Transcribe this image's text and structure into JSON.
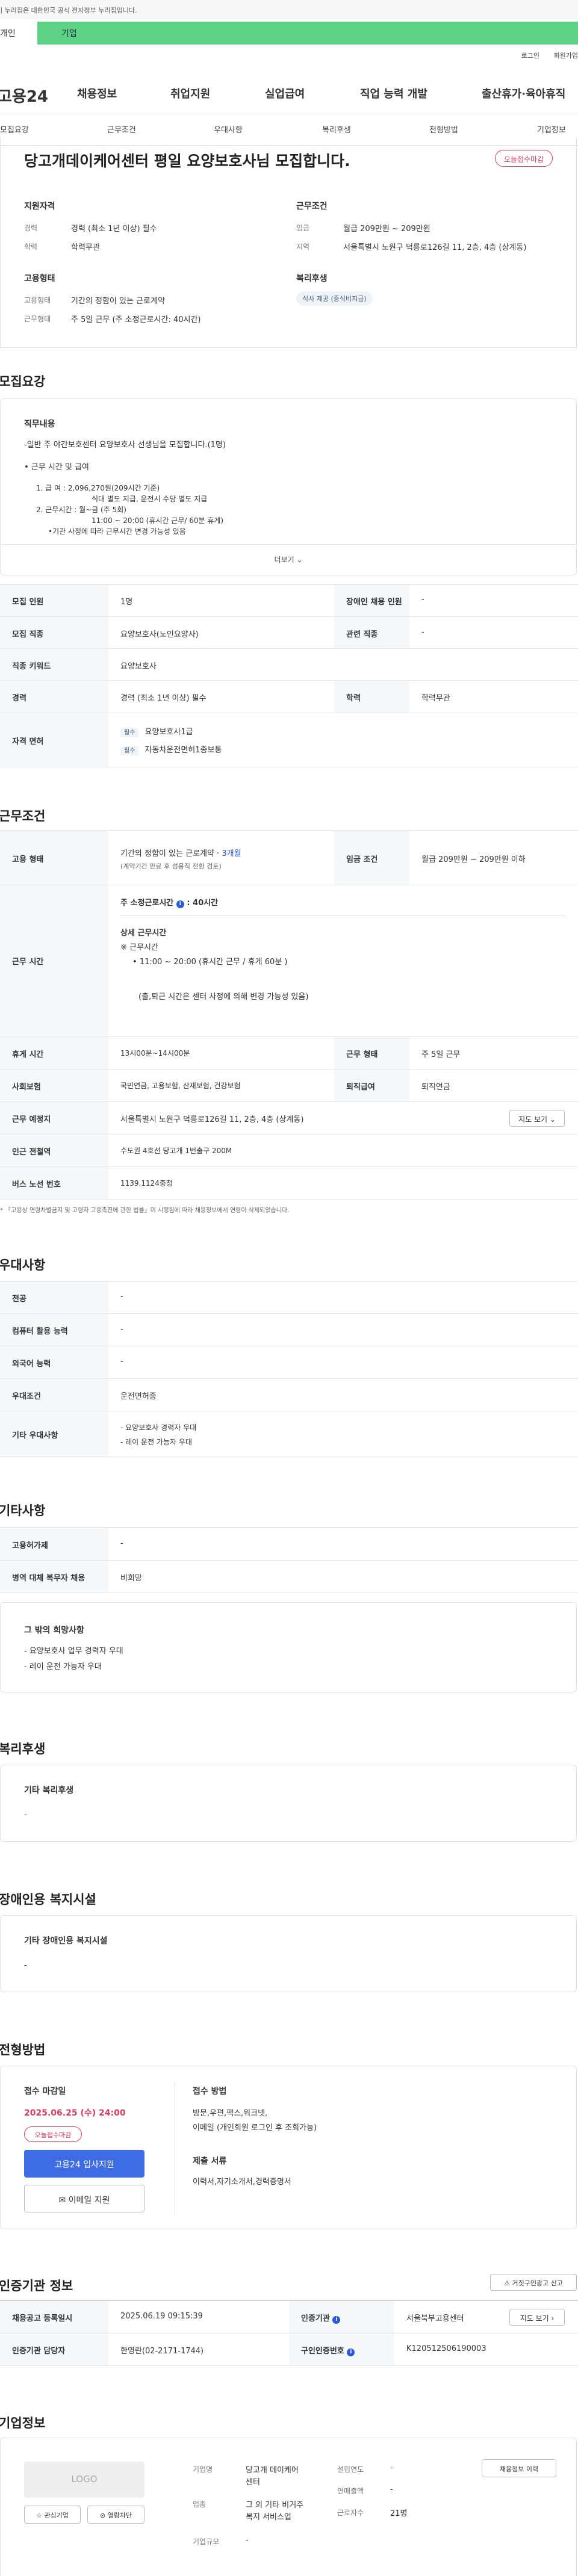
{
  "gov_banner": "이 누리집은 대한민국 공식 전자정부 누리집입니다.",
  "user_tabs": {
    "personal": "개인",
    "company": "기업"
  },
  "util_links": {
    "login": "로그인",
    "signup": "회원가입"
  },
  "logo": "고용24",
  "main_nav": [
    "채용정보",
    "취업지원",
    "실업급여",
    "직업 능력 개발",
    "출산휴가·육아휴직"
  ],
  "sub_nav": [
    "모집요강",
    "근무조건",
    "우대사항",
    "복리후생",
    "전형방법",
    "기업정보"
  ],
  "job": {
    "title": "당고개데이케어센터 평일 요양보호사님 모집합니다.",
    "deadline_badge": "오늘접수마감",
    "qual_head": "지원자격",
    "exp_label": "경력",
    "exp_value": "경력 (최소 1년 이상) 필수",
    "edu_label": "학력",
    "edu_value": "학력무관",
    "work_head": "근무조건",
    "wage_label": "임금",
    "wage_value": "월급 209만원 ~ 209만원",
    "area_label": "지역",
    "area_value": "서울특별시 노원구 덕릉로126길 11, 2층, 4층 (상계동)",
    "emp_head": "고용형태",
    "emp_type_label": "고용형태",
    "emp_type_value": "기간의 정함이 있는 근로계약",
    "hours_label": "근무형태",
    "hours_value": "주 5일 근무 (주 소정근로시간: 40시간)",
    "welfare_head": "복리후생",
    "welfare_pill": "식사 제공 (중식비지급)"
  },
  "recruit": {
    "section_title": "모집요강",
    "duty_head": "직무내용",
    "duty_lines": [
      "-일반 주 야간보호센터 요양보호사 선생님을 모집합니다.(1명)",
      "• 근무 시간 및 급여",
      "1. 급        여 : 2,096,270원(209시간 기준)",
      "식대 별도 지급, 운전시 수당 별도 지급",
      "2. 근무시간 : 월~금 (주 5회)",
      "11:00 ~ 20:00 (휴시간 근무/ 60분 휴게)",
      "•기관 사정에 따라 근무시간 변경 가능성 있음"
    ],
    "more_button": "더보기",
    "rows": [
      {
        "l1": "모집 인원",
        "v1": "1명",
        "l2": "장애인 채용 인원",
        "v2": "-"
      },
      {
        "l1": "모집 직종",
        "v1": "요양보호사(노인요양사)",
        "l2": "관련 직종",
        "v2": "-"
      },
      {
        "l1": "직종 키워드",
        "v1": "요양보호사"
      },
      {
        "l1": "경력",
        "v1": "경력 (최소 1년 이상) 필수",
        "l2": "학력",
        "v2": "학력무관"
      }
    ],
    "license_label": "자격 면허",
    "licenses": [
      {
        "tag": "필수",
        "name": "요양보호사1급"
      },
      {
        "tag": "필수",
        "name": "자동차운전면허1종보통"
      }
    ]
  },
  "conditions": {
    "section_title": "근무조건",
    "emp_label": "고용 형태",
    "emp_value_1": "기간의 정함이 있는 근로계약 ·",
    "emp_value_link": "3개월",
    "emp_value_2": "(계약기간 만료 후 성용직 전환 검토)",
    "wage_label": "임금 조건",
    "wage_value": "월급 209만원 ~ 209만원 이하",
    "hours_label": "근무 시간",
    "hours_weekly": "주 소정근로시간",
    "hours_weekly_value": ": 40시간",
    "detail_head": "상세 근무시간",
    "detail_sub": "※ 근무시간",
    "detail_time": "11:00 ~ 20:00 (휴시간 근무 / 휴게 60분 )",
    "detail_note": "(출,퇴근 시간은 센터 사정에 의해 변경 가능성 있음)",
    "rows": [
      {
        "l1": "휴게 시간",
        "v1": "13시00분~14시00분",
        "l2": "근무 형태",
        "v2": "주 5일 근무"
      },
      {
        "l1": "사회보험",
        "v1": "국민연금, 고용보험, 산재보험, 건강보험",
        "l2": "퇴직급여",
        "v2": "퇴직연금"
      }
    ],
    "place_label": "근무 예정지",
    "place_value": "서울특별시 노원구 덕릉로126길 11, 2층, 4층 (상계동)",
    "map_button": "지도 보기",
    "subway_label": "인근 전철역",
    "subway_value": "수도권 4호선 당고개 1번출구 200M",
    "bus_label": "버스 노선 번호",
    "bus_value": "1139,1124충청",
    "footnote": "* 「고용상 연령차별금지 및 고령자 고용촉진에 관한 법률」이 시행됨에 따라 채용정보에서 연령이 삭제되었습니다."
  },
  "preference": {
    "section_title": "우대사항",
    "rows": [
      {
        "l": "전공",
        "v": "-"
      },
      {
        "l": "컴퓨터 활용 능력",
        "v": "-"
      },
      {
        "l": "외국어 능력",
        "v": "-"
      },
      {
        "l": "우대조건",
        "v": "운전면허증"
      }
    ],
    "etc_label": "기타 우대사항",
    "etc_lines": [
      "- 요양보호사 경력자 우대",
      "- 레이 운전 가능자 우대"
    ]
  },
  "other": {
    "section_title": "기타사항",
    "rows": [
      {
        "l": "고용허가제",
        "v": "-"
      },
      {
        "l": "병역 대체 복무자 채용",
        "v": "비희망"
      }
    ],
    "box_title": "그 밖의 희망사항",
    "box_lines": [
      "- 요양보호사 업무 경력자 우대",
      "- 레이 운전 가능자 우대"
    ]
  },
  "welfare": {
    "section_title": "복리후생",
    "box_title": "기타 복리후생",
    "box_value": "-"
  },
  "disability": {
    "section_title": "장애인용 복지시설",
    "box_title": "기타 장애인용 복지시설",
    "box_value": "-"
  },
  "selection": {
    "section_title": "전형방법",
    "deadline_head": "접수 마감일",
    "deadline_value": "2025.06.25 (수) 24:00",
    "deadline_badge": "오늘접수마감",
    "apply_button": "고용24 입사지원",
    "email_button": "이메일 지원",
    "method_head": "접수 방법",
    "method_value_1": "방문,우편,팩스,워크넷,",
    "method_value_2": "이메일 (개인회원 로그인 후 조회가능)",
    "docs_head": "제출 서류",
    "docs_value": "이력서,자기소개서,경력증명서"
  },
  "agency": {
    "section_title": "인증기관 정보",
    "report_button": "거짓구인광고 신고",
    "reg_label": "채용공고 등록일시",
    "reg_value": "2025.06.19 09:15:39",
    "org_label": "인증기관",
    "org_value": "서울북부고용센터",
    "map_button": "지도 보기",
    "manager_label": "인증기관 담당자",
    "manager_value": "한영란(02-2171-1744)",
    "id_label": "구인인증번호",
    "id_value": "K120512506190003"
  },
  "company": {
    "section_title": "기업정보",
    "logo_text": "LOGO",
    "interest_button": "관심기업",
    "block_button": "열람차단",
    "name_label": "기업명",
    "name_value_1": "당고개 데이케어",
    "name_value_2": "센터",
    "industry_label": "업종",
    "industry_value_1": "그 외 기타 비거주",
    "industry_value_2": "복지 서비스업",
    "scale_label": "기업규모",
    "scale_value": "-",
    "founded_label": "설립연도",
    "founded_value": "-",
    "revenue_label": "연매출액",
    "revenue_value": "-",
    "employees_label": "근로자수",
    "employees_value": "21명",
    "info_button": "채용정보 이력"
  }
}
